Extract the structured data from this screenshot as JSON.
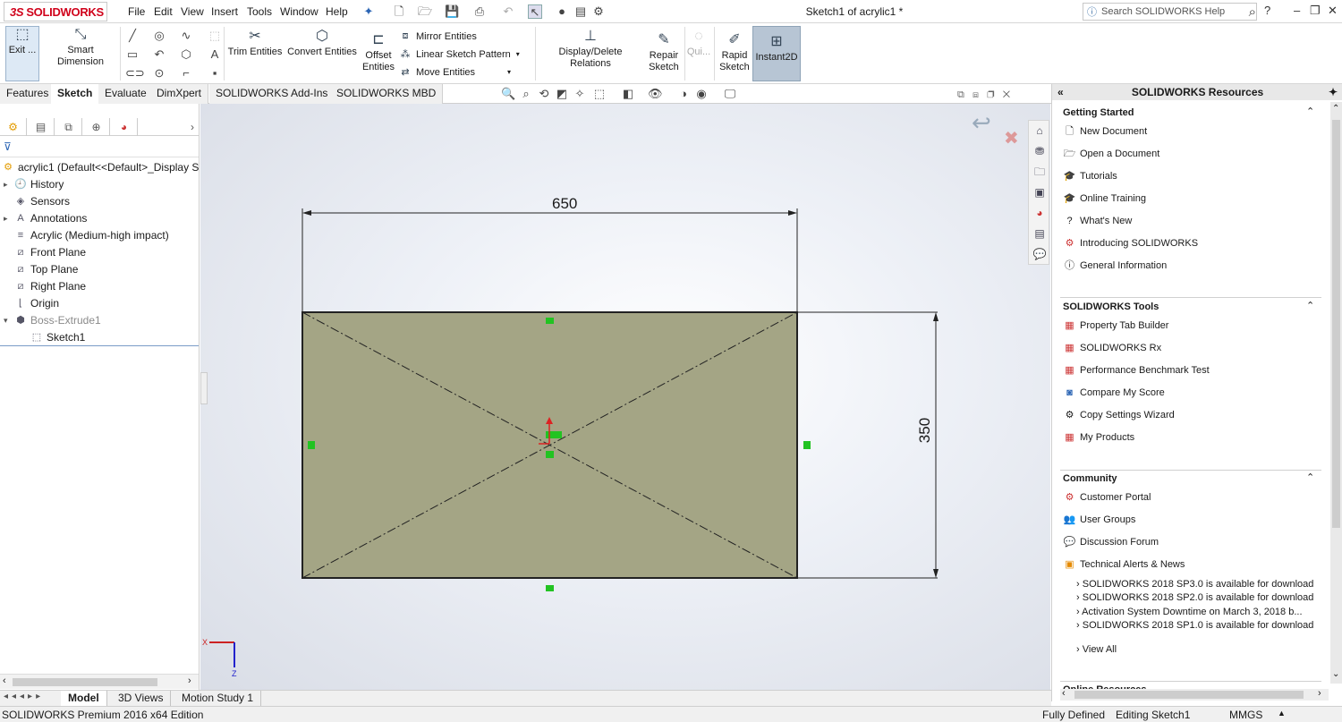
{
  "app": {
    "logo_prefix": "3S",
    "logo": "SOLIDWORKS",
    "doc_title": "Sketch1 of acrylic1 *"
  },
  "menu": [
    "File",
    "Edit",
    "View",
    "Insert",
    "Tools",
    "Window",
    "Help"
  ],
  "search": {
    "placeholder": "Search SOLIDWORKS Help"
  },
  "ribbon": {
    "exit_label": "Exit ...",
    "smart_dimension": "Smart Dimension",
    "trim_entities": "Trim Entities",
    "convert_entities": "Convert Entities",
    "offset_entities_1": "Offset",
    "offset_entities_2": "Entities",
    "mirror_entities": "Mirror Entities",
    "linear_sketch_pattern": "Linear Sketch Pattern",
    "move_entities": "Move Entities",
    "display_delete_relations": "Display/Delete Relations",
    "repair_sketch_1": "Repair",
    "repair_sketch_2": "Sketch",
    "quick_snaps": "Qui...",
    "rapid_sketch_1": "Rapid",
    "rapid_sketch_2": "Sketch",
    "instant2d": "Instant2D"
  },
  "tabs": [
    "Features",
    "Sketch",
    "Evaluate",
    "DimXpert",
    "SOLIDWORKS Add-Ins",
    "SOLIDWORKS MBD"
  ],
  "tree": {
    "root": "acrylic1  (Default<<Default>_Display S",
    "items": [
      "History",
      "Sensors",
      "Annotations",
      "Acrylic (Medium-high impact)",
      "Front Plane",
      "Top Plane",
      "Right Plane",
      "Origin",
      "Boss-Extrude1",
      "Sketch1"
    ]
  },
  "sketch": {
    "dim_width": "650",
    "dim_height": "350"
  },
  "resources": {
    "header": "SOLIDWORKS Resources",
    "getting_started": {
      "title": "Getting Started",
      "items": [
        "New Document",
        "Open a Document",
        "Tutorials",
        "Online Training",
        "What's New",
        "Introducing SOLIDWORKS",
        "General Information"
      ]
    },
    "tools": {
      "title": "SOLIDWORKS Tools",
      "items": [
        "Property Tab Builder",
        "SOLIDWORKS Rx",
        "Performance Benchmark Test",
        "Compare My Score",
        "Copy Settings Wizard",
        "My Products"
      ]
    },
    "community": {
      "title": "Community",
      "items": [
        "Customer Portal",
        "User Groups",
        "Discussion Forum",
        "Technical Alerts & News"
      ]
    },
    "news": [
      "SOLIDWORKS 2018 SP3.0 is available for download",
      "SOLIDWORKS 2018 SP2.0 is available for download",
      "Activation System Downtime on March 3, 2018 b...",
      "SOLIDWORKS 2018 SP1.0 is available for download"
    ],
    "view_all": "View All",
    "online_resources": "Online Resources"
  },
  "bottom_tabs": [
    "Model",
    "3D Views",
    "Motion Study 1"
  ],
  "status": {
    "edition": "SOLIDWORKS Premium 2016 x64 Edition",
    "state": "Fully Defined",
    "editing": "Editing Sketch1",
    "units": "MMGS"
  }
}
